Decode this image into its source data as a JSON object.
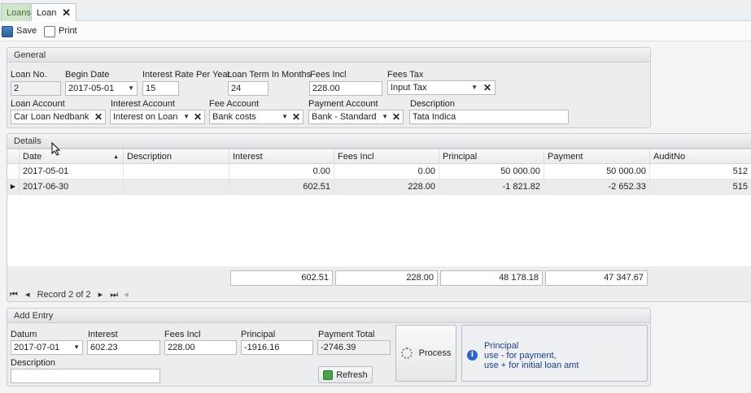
{
  "tabs": [
    {
      "label": "Loans"
    },
    {
      "label": "Loan",
      "close": "✕"
    }
  ],
  "toolbar": {
    "save_label": "Save",
    "print_label": "Print"
  },
  "general": {
    "title": "General",
    "loan_no": {
      "label": "Loan No.",
      "value": "2"
    },
    "begin_date": {
      "label": "Begin Date",
      "value": "2017-05-01"
    },
    "interest_rate": {
      "label": "Interest Rate Per Year",
      "value": "15"
    },
    "loan_term": {
      "label": "Loan Term In Months",
      "value": "24"
    },
    "fees_incl": {
      "label": "Fees Incl",
      "value": "228.00"
    },
    "fees_tax": {
      "label": "Fees Tax",
      "value": "Input Tax"
    },
    "loan_account": {
      "label": "Loan Account",
      "value": "Car Loan Nedbank"
    },
    "interest_account": {
      "label": "Interest Account",
      "value": "Interest on Loan"
    },
    "fee_account": {
      "label": "Fee Account",
      "value": "Bank costs"
    },
    "payment_account": {
      "label": "Payment Account",
      "value": "Bank - Standard"
    },
    "description": {
      "label": "Description",
      "value": "Tata Indica"
    }
  },
  "details": {
    "title": "Details",
    "columns": [
      "Date",
      "Description",
      "Interest",
      "Fees Incl",
      "Principal",
      "Payment",
      "AuditNo"
    ],
    "rows": [
      {
        "date": "2017-05-01",
        "description": "",
        "interest": "0.00",
        "fees_incl": "0.00",
        "principal": "50 000.00",
        "payment": "50 000.00",
        "audit": "512"
      },
      {
        "date": "2017-06-30",
        "description": "",
        "interest": "602.51",
        "fees_incl": "228.00",
        "principal": "-1 821.82",
        "payment": "-2 652.33",
        "audit": "515"
      }
    ],
    "totals": {
      "interest": "602.51",
      "fees_incl": "228.00",
      "principal": "48 178.18",
      "payment": "47 347.67"
    },
    "navigator": {
      "record_text": "Record 2 of 2"
    }
  },
  "add_entry": {
    "title": "Add Entry",
    "datum": {
      "label": "Datum",
      "value": "2017-07-01"
    },
    "interest": {
      "label": "Interest",
      "value": "602.23"
    },
    "fees_incl": {
      "label": "Fees Incl",
      "value": "228.00"
    },
    "principal": {
      "label": "Principal",
      "value": "-1916.16"
    },
    "payment_total": {
      "label": "Payment Total",
      "value": "-2746.39"
    },
    "description": {
      "label": "Description",
      "value": ""
    },
    "process_label": "Process",
    "refresh_label": "Refresh",
    "info": {
      "line1": "Principal",
      "line2": "use - for payment,",
      "line3": "use + for initial loan amt"
    }
  },
  "colors": {
    "accent": "#2a66c4",
    "tab_active_green": "#cfe6c8"
  }
}
